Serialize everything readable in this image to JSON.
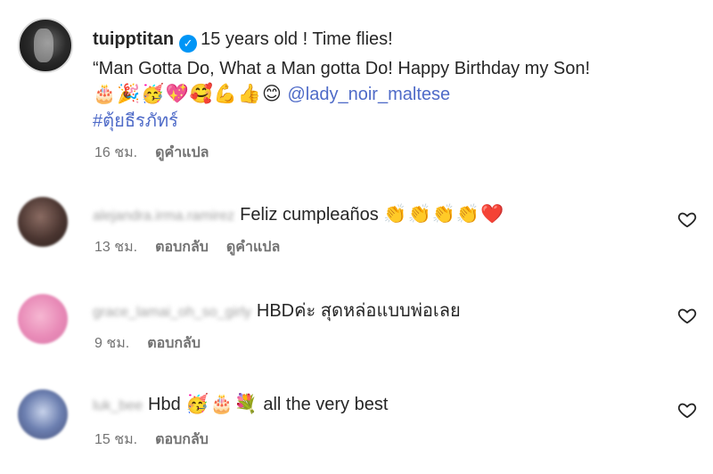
{
  "caption": {
    "username": "tuipptitan",
    "verified_mark": "✓",
    "text_line1": "15 years old ! Time flies!",
    "text_line2": "“Man Gotta Do, What a Man gotta Do! Happy Birthday my Son!",
    "emojis": "🎂🎉🥳💖🥰💪👍😊",
    "mention": "@lady_noir_maltese",
    "hashtag": "#ตุ้ยธีรภัทร์",
    "time": "16 ชม.",
    "translate": "ดูคำแปล"
  },
  "comments": [
    {
      "username": "alejandra.irma.ramirez",
      "text": "Feliz cumpleaños",
      "emojis": "👏👏👏👏❤️",
      "time": "13 ชม.",
      "reply": "ตอบกลับ",
      "translate": "ดูคำแปล"
    },
    {
      "username": "grace_lamai_oh_so_girly",
      "text": "HBDค่ะ สุดหล่อแบบพ่อเลย",
      "time": "9 ชม.",
      "reply": "ตอบกลับ"
    },
    {
      "username": "luk_bee",
      "text_before": "Hbd",
      "emojis": "🥳🎂💐",
      "text_after": "all the very best",
      "time": "15 ชม.",
      "reply": "ตอบกลับ"
    }
  ],
  "icons": {
    "like": "heart-icon",
    "verified": "verified-badge-icon"
  },
  "colors": {
    "link": "#4f6bc8",
    "verified": "#0095f6",
    "meta": "#737373"
  }
}
